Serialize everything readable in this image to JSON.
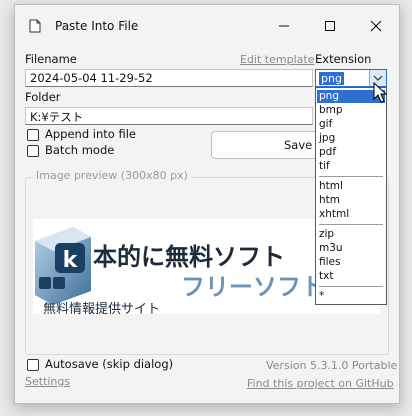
{
  "window": {
    "title": "Paste Into File"
  },
  "form": {
    "filename_label": "Filename",
    "filename_value": "2024-05-04 11-29-52",
    "edit_template_link": "Edit template",
    "extension_label": "Extension",
    "extension_value": "png",
    "folder_label": "Folder",
    "folder_value": "K:¥テスト",
    "append_label": "Append into file",
    "batch_label": "Batch mode",
    "save_button": "Save",
    "preview_label": "Image preview (300x80 px)",
    "autosave_label": "Autosave (skip dialog)",
    "settings_link": "Settings",
    "version_text": "Version 5.3.1.0 Portable",
    "github_link": "Find this project on GitHub"
  },
  "extension_options": [
    "png",
    "bmp",
    "gif",
    "jpg",
    "pdf",
    "tif",
    "html",
    "htm",
    "xhtml",
    "zip",
    "m3u",
    "files",
    "txt",
    "*"
  ],
  "preview_image": {
    "top_text": "本的に無料ソフト",
    "bottom_text": "フリーソフト",
    "caption": "無料情報提供サイト",
    "logo_letter": "k"
  },
  "colors": {
    "accent": "#2f6fd1",
    "window_bg": "#f3f3f3",
    "muted_text": "#8a8a8a"
  }
}
